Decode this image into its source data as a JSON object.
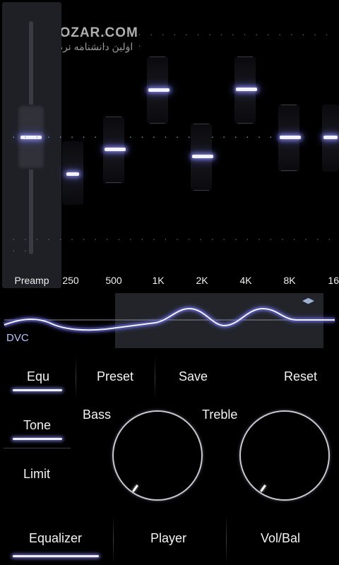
{
  "watermark": {
    "brand": "SOFTGOZAR.COM",
    "tagline": "اولین دانشنامه نرم افزار ایران"
  },
  "equalizer": {
    "preamp_label": "Preamp",
    "bands": [
      {
        "label": "250"
      },
      {
        "label": "500"
      },
      {
        "label": "1K"
      },
      {
        "label": "2K"
      },
      {
        "label": "4K"
      },
      {
        "label": "8K"
      },
      {
        "label": "16"
      }
    ]
  },
  "dvc": {
    "label": "DVC",
    "scroll_arrows": "◀▶"
  },
  "tabs_top": {
    "equ": "Equ",
    "preset": "Preset",
    "save": "Save",
    "reset": "Reset"
  },
  "side_tabs": {
    "tone": "Tone",
    "limit": "Limit"
  },
  "knobs": {
    "bass": "Bass",
    "treble": "Treble"
  },
  "bottom_nav": {
    "equalizer": "Equalizer",
    "player": "Player",
    "volbal": "Vol/Bal"
  }
}
